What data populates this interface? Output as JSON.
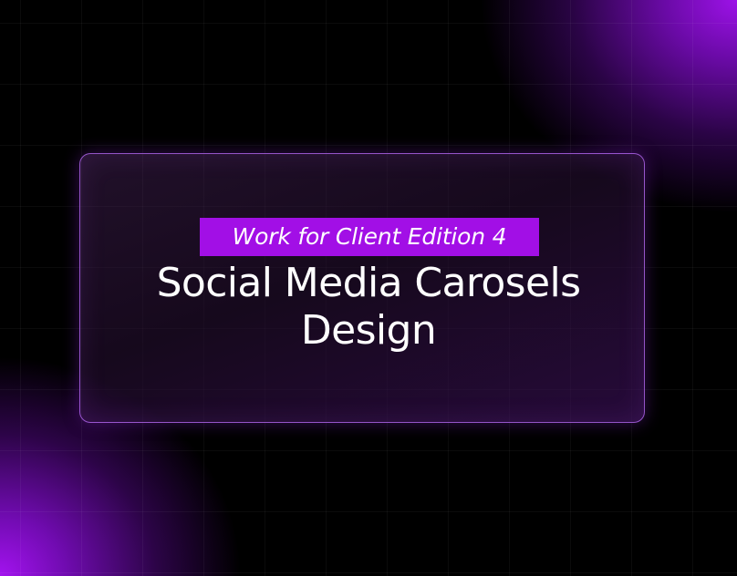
{
  "tag_label": "Work for Client Edition 4",
  "title": {
    "line1": "Social Media Carosels",
    "line2": "Design"
  },
  "colors": {
    "accent": "#a20fe6",
    "background": "#000000",
    "card_border": "#be6eff",
    "text": "#ffffff"
  }
}
